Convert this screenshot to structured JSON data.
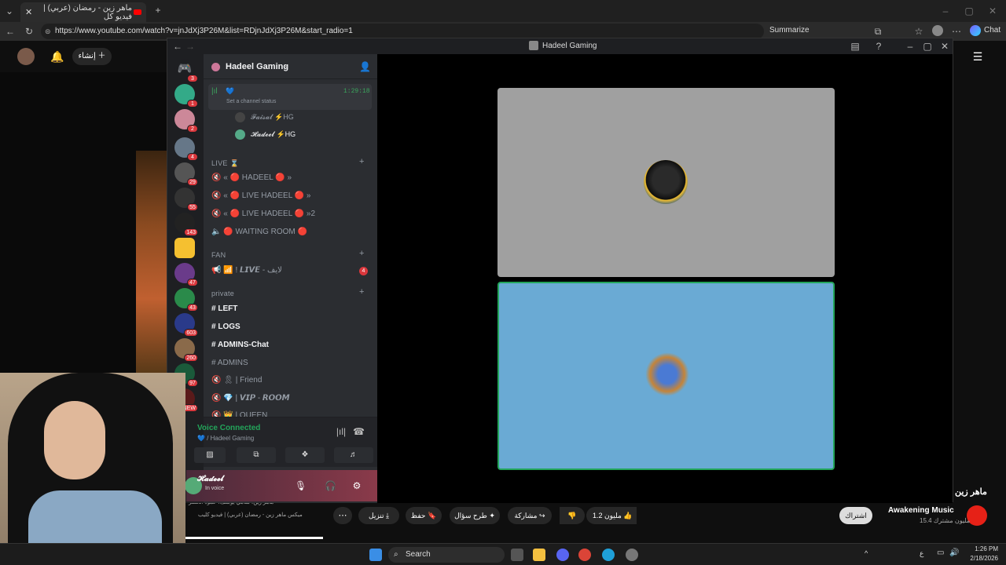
{
  "browser": {
    "tab_title": "ماهر زين - رمضان (عربي) | فيديو كل",
    "url": "https://www.youtube.com/watch?v=jnJdXj3P26M&list=RDjnJdXj3P26M&start_radio=1",
    "summarize_label": "Summarize",
    "chat_label": "Chat"
  },
  "youtube": {
    "create_label": "إنشاء",
    "channel_name": "Awakening Music",
    "subscribers": "15.4 مليون مشترك",
    "subscribe_label": "اشتراك",
    "likes": "1.2 مليون",
    "share_label": "مشاركة",
    "ask_label": "طرح سؤال",
    "save_label": "حفظ",
    "download_label": "تنزيل",
    "artist_title": "ماهر زين",
    "mix_line1": "ميكس ماهر زين - رمضان (عربي) | فيديو كليب",
    "mix_line2": "ماهر زين، سامي يوسف، حمود الخضر"
  },
  "discord": {
    "window_title": "Hadeel Gaming",
    "server_name": "Hadeel Gaming",
    "voice_timer": "1:29:18",
    "channel_status": "Set a channel status",
    "voice_users": [
      "𝓕𝓪𝓲𝓼𝓪𝓵 ⚡HG",
      "𝓗𝓪𝓭𝓮𝓮𝓵 ⚡HG"
    ],
    "categories": {
      "live": "LIVE ⌛",
      "fan": "FAN",
      "private": "private"
    },
    "live_channels": [
      "« 🔴 HADEEL 🔴 »",
      "« 🔴 LIVE HADEEL 🔴 »",
      "« 🔴 LIVE HADEEL 🔴 »2",
      "🔴 WAITING ROOM 🔴"
    ],
    "fan_channels": [
      "📶 ! 𝙇𝙄𝙑𝙀 - لايف"
    ],
    "fan_badge": "4",
    "private_channels": [
      "LEFT",
      "LOGS",
      "ADMINS-Chat",
      "ADMINS",
      "🎗 | Friend",
      "💎 | 𝙑𝙄𝙋 - 𝙍𝙊𝙊𝙈",
      "👑 | QUEEN"
    ],
    "voice_connected": "Voice Connected",
    "voice_server": "💙 / Hadeel Gaming",
    "user_name": "𝓗𝓪𝓭𝓮𝓮𝓵",
    "user_status": "In voice",
    "server_badges": [
      "3",
      "1",
      "2",
      "4",
      "29",
      "55",
      "143",
      "",
      "47",
      "43",
      "603",
      "260",
      "97",
      "NEW"
    ]
  },
  "taskbar": {
    "search_label": "Search",
    "time": "1:26 PM",
    "date": "2/18/2026",
    "lang": "ع"
  },
  "colors": {
    "discord_green": "#23a55a",
    "tile_top": "#a0a0a0",
    "tile_bottom": "#6aaad4",
    "red": "#da373c"
  }
}
